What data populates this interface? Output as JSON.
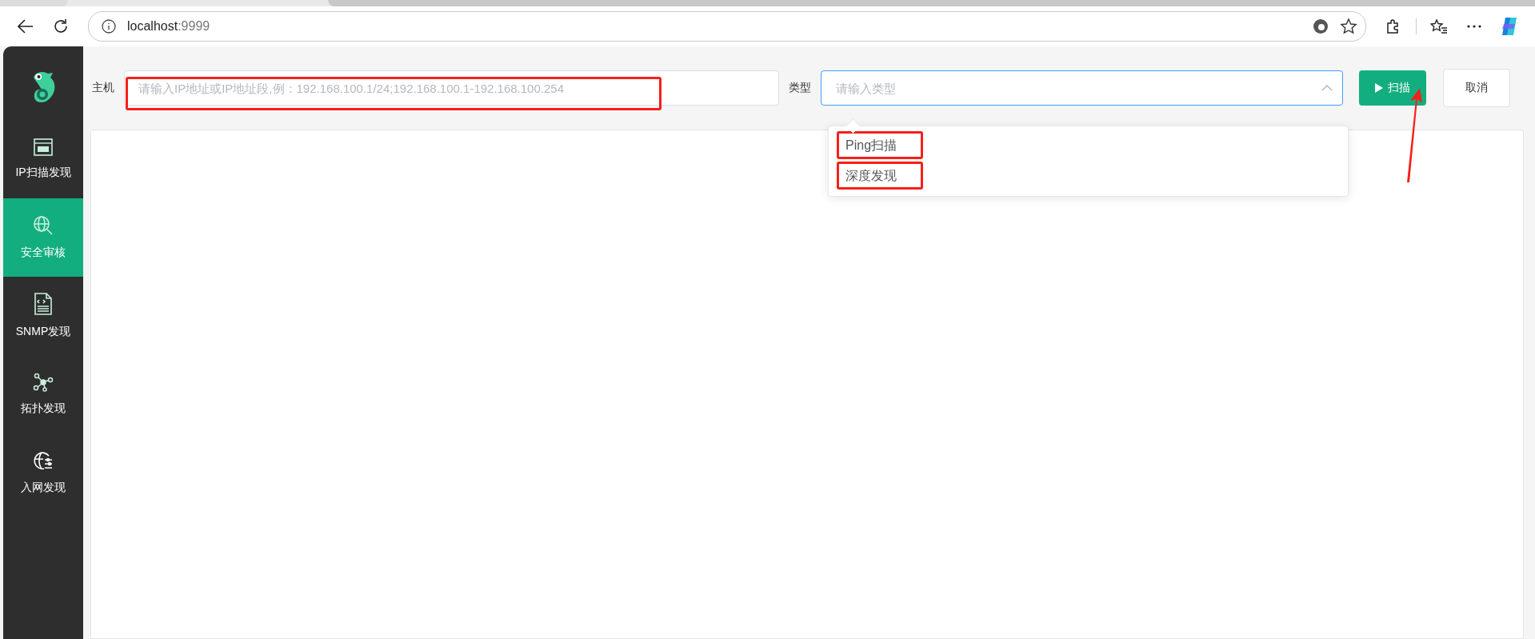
{
  "browser": {
    "host": "localhost",
    "port": ":9999"
  },
  "sidebar": {
    "items": [
      {
        "label": "IP扫描发现",
        "kind": "ping",
        "selected": false
      },
      {
        "label": "安全审核",
        "kind": "globe",
        "selected": true
      },
      {
        "label": "SNMP发现",
        "kind": "document",
        "selected": false
      },
      {
        "label": "拓扑发现",
        "kind": "topology",
        "selected": false
      },
      {
        "label": "入网发现",
        "kind": "network",
        "selected": false
      }
    ]
  },
  "form": {
    "host_label": "主机",
    "host_placeholder": "请输入IP地址或IP地址段,例：192.168.100.1/24;192.168.100.1-192.168.100.254",
    "type_label": "类型",
    "type_placeholder": "请输入类型",
    "scan_button": "扫描",
    "cancel_button": "取消"
  },
  "dropdown": {
    "options": [
      {
        "label": "Ping扫描"
      },
      {
        "label": "深度发现"
      }
    ]
  }
}
